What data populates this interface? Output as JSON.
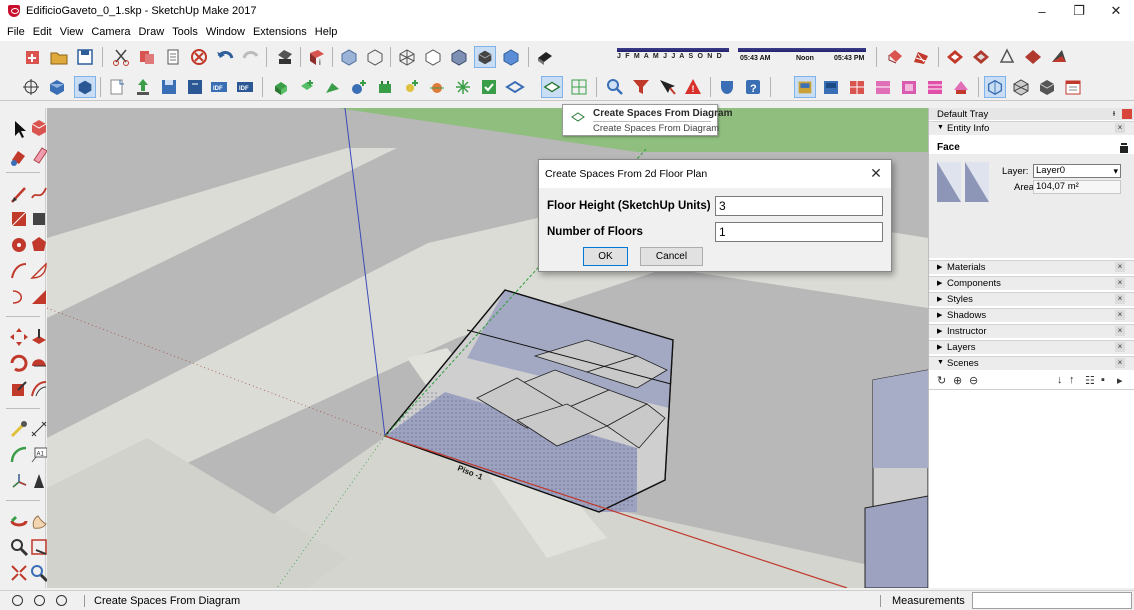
{
  "window": {
    "title": "EdificioGaveto_0_1.skp - SketchUp Make 2017",
    "minimize": "–",
    "maximize": "❐",
    "close": "✕"
  },
  "menu": [
    "File",
    "Edit",
    "View",
    "Camera",
    "Draw",
    "Tools",
    "Window",
    "Extensions",
    "Help"
  ],
  "shadows": {
    "months": "J F M A M J J A S O N D",
    "time_start": "05:43 AM",
    "time_mid": "Noon",
    "time_end": "05:43 PM"
  },
  "tooltip": {
    "title": "Create Spaces From Diagram",
    "subtitle": "Create Spaces From Diagram"
  },
  "dialog": {
    "title": "Create Spaces From 2d Floor Plan",
    "close": "✕",
    "floor_height_label": "Floor Height (SketchUp Units)",
    "floor_height_value": "3",
    "floors_label": "Number of Floors",
    "floors_value": "1",
    "ok_label": "OK",
    "cancel_label": "Cancel"
  },
  "viewport": {
    "floor_label": "Piso -1"
  },
  "tray": {
    "title": "Default Tray",
    "pin": "ᵻ",
    "entity_info": {
      "header": "Entity Info",
      "type": "Face",
      "layer_label": "Layer:",
      "layer_value": "Layer0",
      "area_label": "Area:",
      "area_value": "104,07 m²"
    },
    "panels": [
      {
        "label": "Materials",
        "expanded": false
      },
      {
        "label": "Components",
        "expanded": false
      },
      {
        "label": "Styles",
        "expanded": false
      },
      {
        "label": "Shadows",
        "expanded": false
      },
      {
        "label": "Instructor",
        "expanded": false
      },
      {
        "label": "Layers",
        "expanded": false
      },
      {
        "label": "Scenes",
        "expanded": true
      }
    ]
  },
  "status": {
    "text": "Create Spaces From Diagram",
    "measurements_label": "Measurements",
    "measurements_value": ""
  },
  "colors": {
    "sky_green": "#8fbe7e",
    "ground": "#b8b8b8",
    "road": "#dcdcd6",
    "floor_fill": "#9aa0bc",
    "slab": "#cfcfcf",
    "axis_red": "#c0392b",
    "axis_blue": "#3a4ab8",
    "axis_green": "#2e9e3a"
  }
}
